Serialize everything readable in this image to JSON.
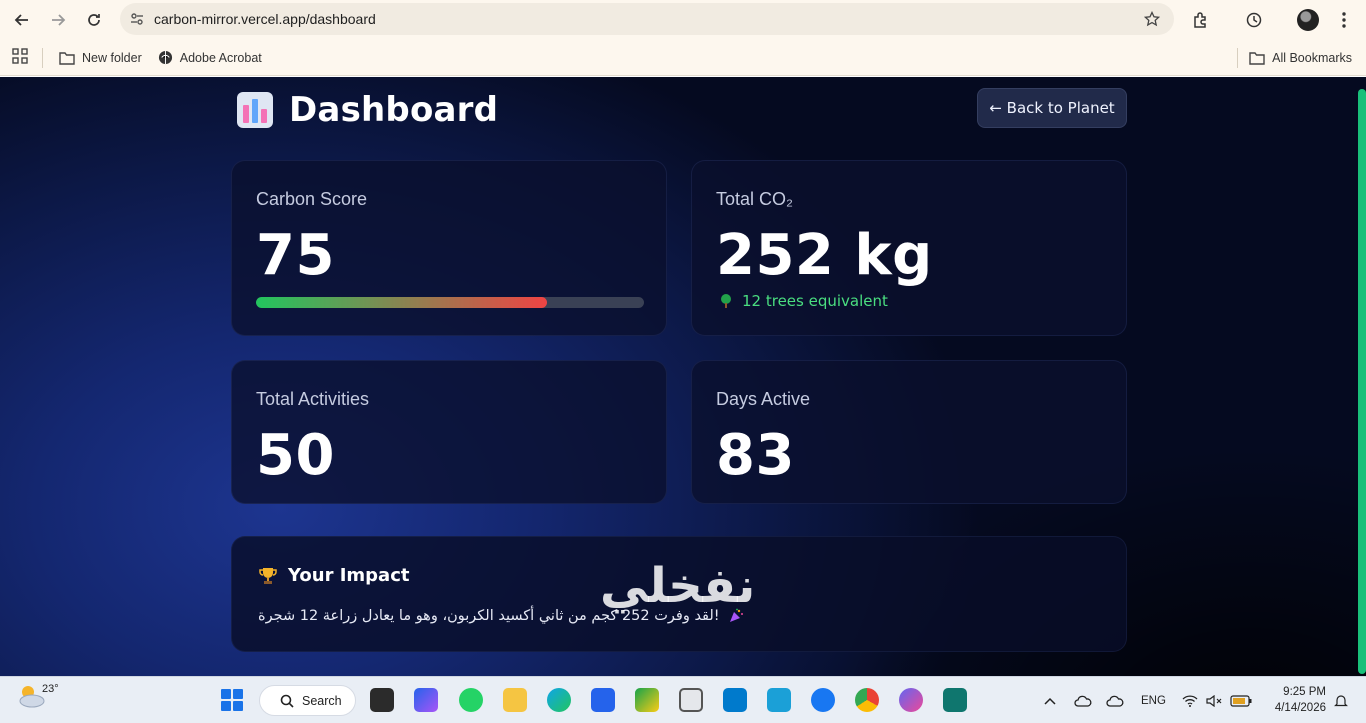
{
  "browser": {
    "url": "carbon-mirror.vercel.app/dashboard",
    "bookmarks": [
      "New folder",
      "Adobe Acrobat"
    ],
    "all_bookmarks": "All Bookmarks"
  },
  "dashboard": {
    "title": "Dashboard",
    "back_button": "← Back to Planet",
    "cards": {
      "carbon_score": {
        "label": "Carbon Score",
        "value": "75",
        "progress_percent": 75
      },
      "total_co2": {
        "label": "Total CO₂",
        "value": "252 kg",
        "trees": "12 trees equivalent"
      },
      "total_activities": {
        "label": "Total Activities",
        "value": "50"
      },
      "days_active": {
        "label": "Days Active",
        "value": "83"
      }
    },
    "impact": {
      "title": "Your Impact",
      "message": "!لقد وفرت 252 كجم من ثاني أكسيد الكربون، وهو ما يعادل زراعة 12 شجرة"
    }
  },
  "watermark": "نفخلي",
  "taskbar": {
    "weather_temp": "23°",
    "search_label": "Search",
    "language": "ENG",
    "time": "9:25 PM",
    "date": "4/14/2026"
  },
  "colors": {
    "accent_green": "#4ade80",
    "progress_start": "#22c55e",
    "progress_end": "#ef4444"
  }
}
